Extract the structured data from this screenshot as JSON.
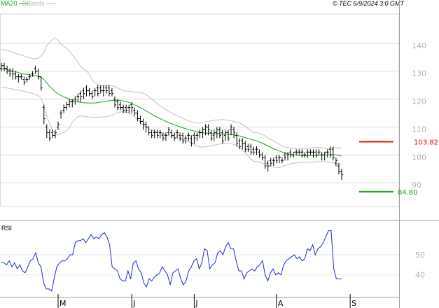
{
  "header": {
    "ma_label": "MA20",
    "bb_label": "BBands",
    "copyright": "© TEC 6/9/2024 3:0 GMT"
  },
  "colors": {
    "ma": "#1aa31a",
    "bbands": "#c0c0c0",
    "price": "#000000",
    "rsi": "#1f2ad4",
    "resistance": "#e01010",
    "support": "#1aa31a",
    "grid": "#dcdcdc",
    "axis_text": "#b4b4b4"
  },
  "chart_data": [
    {
      "type": "ohlc",
      "y_ticks": [
        "140",
        "130",
        "120",
        "110",
        "100",
        "90"
      ],
      "y_tick_values": [
        140,
        130,
        120,
        110,
        100,
        90
      ],
      "ylim": [
        81.5,
        150.5
      ],
      "x_ticks": [
        "M",
        "J",
        "J",
        "A",
        "S"
      ],
      "x_tick_index": [
        20,
        46,
        68,
        97,
        123
      ],
      "levels": [
        {
          "name": "resistance",
          "label": "103.82",
          "value": 104.7
        },
        {
          "name": "support",
          "label": "84.80",
          "value": 86.8
        }
      ],
      "ohlc": [
        [
          131,
          133,
          130,
          132
        ],
        [
          132,
          133,
          130,
          131
        ],
        [
          131,
          132,
          129,
          130
        ],
        [
          130,
          131,
          128,
          129
        ],
        [
          130,
          131,
          127,
          129
        ],
        [
          129,
          130,
          127,
          128
        ],
        [
          128,
          129,
          126,
          128
        ],
        [
          128,
          129,
          127,
          128
        ],
        [
          127,
          128,
          125,
          126
        ],
        [
          127,
          128,
          126,
          127
        ],
        [
          128,
          129,
          127,
          128
        ],
        [
          129,
          130,
          128,
          129
        ],
        [
          131,
          132,
          129,
          130
        ],
        [
          130,
          131,
          127,
          128
        ],
        [
          128,
          128,
          123,
          124
        ],
        [
          117,
          118,
          111,
          113
        ],
        [
          110,
          111,
          106,
          108
        ],
        [
          108,
          109,
          105,
          106
        ],
        [
          108,
          109,
          106,
          107
        ],
        [
          107,
          109,
          106,
          108
        ],
        [
          110,
          112,
          109,
          111
        ],
        [
          115,
          116,
          113,
          115
        ],
        [
          116,
          118,
          115,
          117
        ],
        [
          117,
          119,
          116,
          118
        ],
        [
          118,
          120,
          117,
          119
        ],
        [
          119,
          120,
          117,
          119
        ],
        [
          120,
          121,
          118,
          120
        ],
        [
          121,
          122,
          119,
          121
        ],
        [
          122,
          123,
          119,
          121
        ],
        [
          123,
          124,
          120,
          122
        ],
        [
          124,
          125,
          121,
          123
        ],
        [
          123,
          124,
          121,
          122
        ],
        [
          122,
          123,
          120,
          121
        ],
        [
          123,
          124,
          121,
          123
        ],
        [
          124,
          125,
          121,
          122
        ],
        [
          124,
          125,
          122,
          123
        ],
        [
          123,
          125,
          121,
          123
        ],
        [
          124,
          125,
          122,
          123
        ],
        [
          124,
          125,
          121,
          122
        ],
        [
          123,
          124,
          121,
          122
        ],
        [
          120,
          121,
          117,
          118
        ],
        [
          119,
          120,
          116,
          117
        ],
        [
          118,
          119,
          116,
          117
        ],
        [
          117,
          118,
          115,
          116
        ],
        [
          117,
          118,
          115,
          116
        ],
        [
          117,
          118,
          115,
          117
        ],
        [
          118,
          119,
          115,
          117
        ],
        [
          116,
          117,
          114,
          115
        ],
        [
          115,
          116,
          112,
          113
        ],
        [
          113,
          114,
          111,
          112
        ],
        [
          112,
          113,
          109,
          111
        ],
        [
          111,
          112,
          108,
          110
        ],
        [
          110,
          110,
          107,
          108
        ],
        [
          108,
          109,
          106,
          107
        ],
        [
          108,
          109,
          106,
          108
        ],
        [
          108,
          109,
          106,
          107
        ],
        [
          108,
          109,
          106,
          108
        ],
        [
          107,
          108,
          105,
          106
        ],
        [
          107,
          108,
          105,
          107
        ],
        [
          108,
          110,
          107,
          109
        ],
        [
          108,
          109,
          106,
          107
        ],
        [
          107,
          108,
          105,
          106
        ],
        [
          108,
          109,
          106,
          108
        ],
        [
          107,
          108,
          105,
          106
        ],
        [
          107,
          108,
          104,
          105
        ],
        [
          106,
          107,
          104,
          106
        ],
        [
          107,
          108,
          105,
          107
        ],
        [
          106,
          107,
          103,
          104
        ],
        [
          107,
          108,
          104,
          106
        ],
        [
          107,
          108,
          105,
          107
        ],
        [
          108,
          109,
          106,
          108
        ],
        [
          108,
          110,
          106,
          109
        ],
        [
          109,
          111,
          107,
          110
        ],
        [
          110,
          111,
          107,
          109
        ],
        [
          108,
          109,
          105,
          106
        ],
        [
          107,
          109,
          105,
          108
        ],
        [
          108,
          110,
          106,
          109
        ],
        [
          109,
          110,
          106,
          107
        ],
        [
          108,
          109,
          104,
          105
        ],
        [
          107,
          109,
          105,
          108
        ],
        [
          108,
          109,
          105,
          106
        ],
        [
          109,
          111,
          107,
          110
        ],
        [
          109,
          110,
          106,
          108
        ],
        [
          107,
          108,
          103,
          104
        ],
        [
          105,
          106,
          102,
          103
        ],
        [
          105,
          106,
          102,
          104
        ],
        [
          104,
          105,
          101,
          102
        ],
        [
          103,
          104,
          101,
          102
        ],
        [
          103,
          104,
          100,
          101
        ],
        [
          102,
          103,
          100,
          101
        ],
        [
          102,
          103,
          100,
          102
        ],
        [
          101,
          102,
          99,
          100
        ],
        [
          100,
          101,
          98,
          99
        ],
        [
          99,
          100,
          95,
          96
        ],
        [
          97,
          98,
          94,
          96
        ],
        [
          98,
          99,
          96,
          97
        ],
        [
          98,
          99,
          96,
          98
        ],
        [
          99,
          100,
          97,
          98
        ],
        [
          99,
          100,
          97,
          99
        ],
        [
          98,
          99,
          97,
          98
        ],
        [
          100,
          101,
          98,
          99
        ],
        [
          100,
          101,
          98,
          100
        ],
        [
          101,
          102,
          99,
          100
        ],
        [
          100,
          101,
          99,
          101
        ],
        [
          101,
          102,
          100,
          101
        ],
        [
          101,
          102,
          100,
          101
        ],
        [
          101,
          102,
          99,
          101
        ],
        [
          100,
          101,
          99,
          100
        ],
        [
          101,
          102,
          99,
          101
        ],
        [
          101,
          102,
          100,
          101
        ],
        [
          101,
          102,
          99,
          101
        ],
        [
          101,
          102,
          99,
          100
        ],
        [
          101,
          102,
          100,
          101
        ],
        [
          100,
          101,
          98,
          100
        ],
        [
          100,
          101,
          98,
          101
        ],
        [
          101,
          102,
          99,
          101
        ],
        [
          102,
          103,
          99,
          100
        ],
        [
          102,
          103,
          98,
          99
        ],
        [
          97,
          99,
          96,
          98
        ],
        [
          96,
          97,
          93,
          94
        ],
        [
          94,
          95,
          91,
          93
        ]
      ],
      "ma20": [
        131.0,
        130.9,
        130.6,
        130.3,
        130.0,
        129.8,
        129.5,
        129.3,
        129.0,
        128.9,
        128.7,
        128.5,
        128.4,
        128.2,
        127.8,
        127.0,
        125.8,
        124.6,
        123.6,
        122.6,
        121.9,
        121.3,
        120.8,
        120.4,
        120.0,
        119.6,
        119.2,
        119.0,
        118.8,
        118.7,
        118.6,
        118.6,
        118.6,
        118.6,
        118.7,
        118.9,
        119.0,
        119.2,
        119.4,
        119.5,
        119.6,
        119.6,
        119.5,
        119.3,
        119.1,
        118.8,
        118.4,
        117.9,
        117.4,
        116.9,
        116.4,
        115.8,
        115.2,
        114.6,
        114.0,
        113.5,
        113.0,
        112.5,
        112.0,
        111.6,
        111.2,
        110.8,
        110.4,
        110.0,
        109.7,
        109.4,
        109.1,
        108.8,
        108.5,
        108.3,
        108.1,
        107.9,
        107.8,
        107.8,
        107.7,
        107.6,
        107.6,
        107.6,
        107.5,
        107.4,
        107.4,
        107.3,
        107.2,
        107.0,
        106.8,
        106.5,
        106.2,
        105.9,
        105.6,
        105.3,
        105.0,
        104.6,
        104.2,
        103.7,
        103.2,
        102.7,
        102.2,
        101.8,
        101.4,
        101.0,
        100.7,
        100.4,
        100.2,
        100.0,
        99.9,
        99.8,
        99.7,
        99.7,
        99.7,
        99.7,
        99.8,
        99.8,
        99.9,
        99.9,
        100.0,
        100.0,
        100.1,
        100.1,
        100.0,
        99.8,
        99.6
      ],
      "bb_upper": [
        137.8,
        137.6,
        137.4,
        137.1,
        136.7,
        136.4,
        136.1,
        135.8,
        135.5,
        135.1,
        134.8,
        134.5,
        134.4,
        134.7,
        135.3,
        136.8,
        139.2,
        140.2,
        141.4,
        141.8,
        141.2,
        139.8,
        138.9,
        138.2,
        137.2,
        135.8,
        134.6,
        133.3,
        131.6,
        130.8,
        130.1,
        129.0,
        126.9,
        125.8,
        125.3,
        124.9,
        124.7,
        124.8,
        124.9,
        124.8,
        124.5,
        124.0,
        123.5,
        123.0,
        122.9,
        122.8,
        122.7,
        122.5,
        122.4,
        122.3,
        122.1,
        121.6,
        120.9,
        120.1,
        119.2,
        118.3,
        117.5,
        116.8,
        116.2,
        115.6,
        115.1,
        114.5,
        114.0,
        113.6,
        113.1,
        112.6,
        112.2,
        111.9,
        111.6,
        111.4,
        111.4,
        111.6,
        111.8,
        112.0,
        112.2,
        112.4,
        112.5,
        112.6,
        112.7,
        112.5,
        112.4,
        112.2,
        112.0,
        111.7,
        111.4,
        110.9,
        110.3,
        109.4,
        108.6,
        108.0,
        107.9,
        107.7,
        107.4,
        106.8,
        106.0,
        105.5,
        105.0,
        104.4,
        103.8,
        103.2,
        102.8,
        102.6,
        102.4,
        102.3,
        102.3,
        102.3,
        102.3,
        102.3,
        102.4,
        102.5,
        102.6,
        102.6,
        102.7,
        102.6,
        102.3,
        102.3,
        102.4,
        102.5,
        102.5,
        102.5,
        102.5
      ],
      "bb_lower": [
        124.2,
        124.1,
        124.0,
        123.8,
        123.6,
        123.4,
        123.2,
        123.0,
        122.8,
        122.5,
        122.3,
        122.0,
        121.6,
        121.2,
        120.3,
        117.6,
        113.8,
        111.3,
        108.8,
        107.5,
        107.2,
        107.8,
        108.0,
        108.6,
        109.8,
        111.7,
        112.8,
        113.7,
        114.0,
        113.8,
        113.7,
        113.6,
        113.5,
        113.5,
        113.5,
        113.6,
        113.6,
        113.7,
        113.9,
        114.2,
        114.7,
        115.2,
        115.4,
        115.4,
        115.3,
        115.0,
        114.4,
        113.6,
        112.8,
        111.8,
        110.8,
        110.0,
        109.4,
        108.9,
        108.5,
        108.1,
        107.8,
        107.5,
        107.2,
        106.9,
        106.6,
        106.3,
        106.0,
        105.7,
        105.4,
        105.1,
        104.7,
        104.2,
        103.7,
        103.2,
        102.9,
        102.8,
        102.9,
        103.1,
        103.3,
        103.5,
        103.7,
        103.9,
        104.1,
        104.2,
        104.2,
        104.0,
        103.7,
        103.3,
        102.6,
        101.8,
        100.8,
        99.6,
        98.5,
        97.7,
        97.6,
        97.3,
        97.0,
        96.6,
        96.2,
        95.9,
        95.6,
        95.4,
        95.4,
        95.8,
        96.2,
        96.5,
        96.8,
        97.0,
        97.1,
        97.2,
        97.3,
        97.4,
        97.4,
        97.4,
        97.5,
        97.5,
        97.6,
        97.6,
        97.5,
        97.4,
        97.3,
        97.2,
        97.0,
        96.8,
        96.6
      ]
    },
    {
      "type": "line",
      "title": "RSI",
      "y_ticks": [
        "50",
        "40"
      ],
      "y_tick_values": [
        50,
        40
      ],
      "ylim": [
        30.5,
        66
      ],
      "values": [
        46,
        46,
        45,
        47,
        44,
        46,
        43,
        45,
        42,
        41,
        44,
        47,
        48,
        51,
        46,
        44,
        36,
        33,
        33,
        32,
        38,
        44,
        46,
        47,
        47,
        48,
        50,
        50,
        56,
        57,
        57,
        58,
        56,
        58,
        60,
        58,
        59,
        58,
        60,
        61,
        59,
        55,
        44,
        43,
        42,
        38,
        37,
        37,
        42,
        38,
        46,
        47,
        43,
        41,
        36,
        34,
        38,
        37,
        39,
        40,
        41,
        44,
        42,
        40,
        35,
        41,
        42,
        43,
        38,
        35,
        37,
        42,
        44,
        47,
        48,
        43,
        46,
        53,
        52,
        43,
        45,
        46,
        51,
        52,
        50,
        54,
        56,
        53,
        53,
        47,
        42,
        42,
        38,
        41,
        42,
        43,
        42,
        44,
        45,
        47,
        40,
        37,
        41,
        43,
        40,
        41,
        40,
        45,
        47,
        48,
        49,
        50,
        48,
        49,
        47,
        48,
        53,
        52,
        55,
        50,
        53,
        54,
        56,
        59,
        62,
        62,
        43,
        38,
        38,
        38
      ]
    }
  ]
}
